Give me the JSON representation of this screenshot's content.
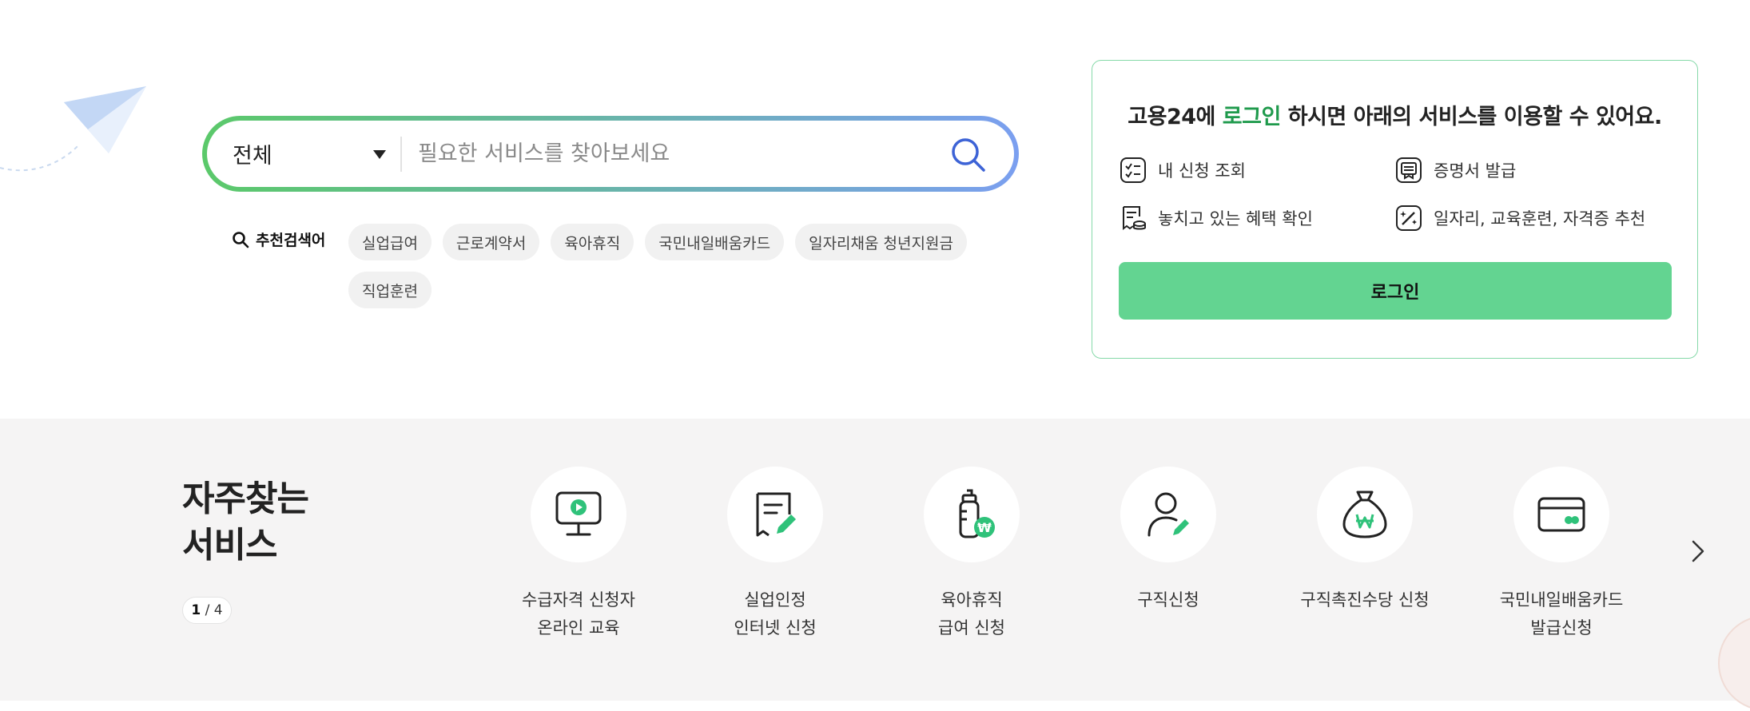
{
  "search": {
    "category_selected": "전체",
    "placeholder": "필요한 서비스를 찾아보세요"
  },
  "recommend": {
    "label": "추천검색어",
    "keywords": [
      "실업급여",
      "근로계약서",
      "육아휴직",
      "국민내일배움카드",
      "일자리채움 청년지원금",
      "직업훈련"
    ]
  },
  "login_card": {
    "title_before": "고용24에 ",
    "title_highlight": "로그인",
    "title_after": " 하시면 아래의 서비스를 이용할 수 있어요.",
    "services": [
      "내 신청 조회",
      "증명서 발급",
      "놓치고 있는 혜택 확인",
      "일자리, 교육훈련, 자격증 추천"
    ],
    "button_label": "로그인"
  },
  "frequent": {
    "title_line1": "자주찾는",
    "title_line2": "서비스",
    "pager_current": "1",
    "pager_sep": " / ",
    "pager_total": "4",
    "items": [
      {
        "line1": "수급자격 신청자",
        "line2": "온라인 교육",
        "icon": "monitor-play-icon"
      },
      {
        "line1": "실업인정",
        "line2": "인터넷 신청",
        "icon": "document-edit-icon"
      },
      {
        "line1": "육아휴직",
        "line2": "급여 신청",
        "icon": "baby-bottle-won-icon"
      },
      {
        "line1": "구직신청",
        "line2": "",
        "icon": "person-edit-icon"
      },
      {
        "line1": "구직촉진수당 신청",
        "line2": "",
        "icon": "money-bag-won-icon"
      },
      {
        "line1": "국민내일배움카드",
        "line2": "발급신청",
        "icon": "card-icon"
      }
    ]
  },
  "colors": {
    "accent_green": "#63d491",
    "highlight_green": "#1f9a4c",
    "icon_green": "#2fc27a"
  }
}
